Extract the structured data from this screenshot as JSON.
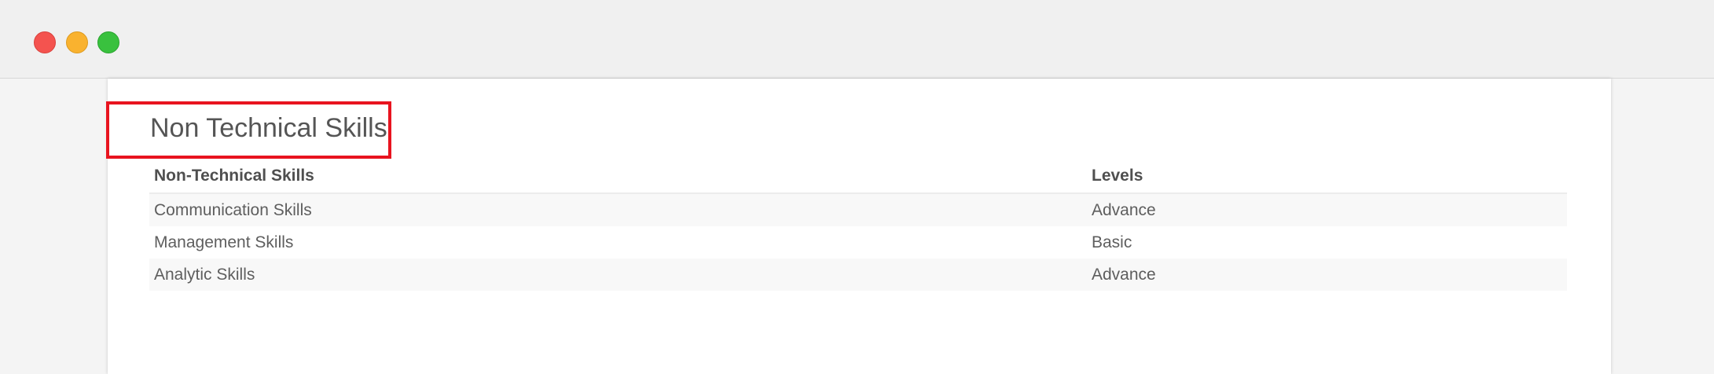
{
  "section": {
    "title": "Non Technical Skills"
  },
  "table": {
    "headers": {
      "skill": "Non-Technical Skills",
      "level": "Levels"
    },
    "rows": [
      {
        "skill": "Communication Skills",
        "level": "Advance"
      },
      {
        "skill": "Management Skills",
        "level": "Basic"
      },
      {
        "skill": "Analytic Skills",
        "level": "Advance"
      }
    ]
  },
  "colors": {
    "highlight": "#e8141f",
    "window_close": "#f4534f",
    "window_minimize": "#f9b22f",
    "window_zoom": "#39c13e"
  }
}
